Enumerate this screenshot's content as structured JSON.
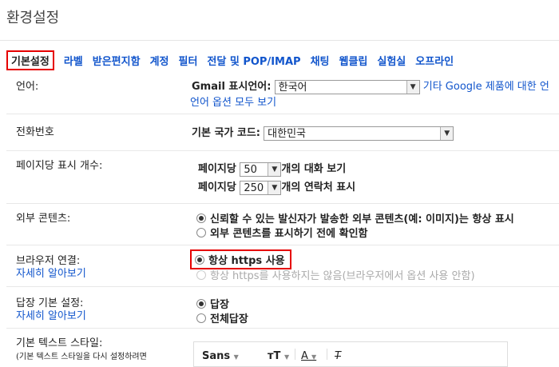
{
  "page": {
    "title": "환경설정"
  },
  "tabs": [
    {
      "label": "기본설정"
    },
    {
      "label": "라벨"
    },
    {
      "label": "받은편지함"
    },
    {
      "label": "계정"
    },
    {
      "label": "필터"
    },
    {
      "label": "전달 및 POP/IMAP"
    },
    {
      "label": "채팅"
    },
    {
      "label": "웹클립"
    },
    {
      "label": "실험실"
    },
    {
      "label": "오프라인"
    }
  ],
  "language": {
    "label": "언어:",
    "display_label": "Gmail 표시언어:",
    "selected": "한국어",
    "other_link": "기타 Google 제품에 대한 언",
    "more_link": "언어 옵션 모두 보기"
  },
  "phone": {
    "label": "전화번호",
    "country_label": "기본 국가 코드:",
    "selected": "대한민국"
  },
  "page_size": {
    "label": "페이지당 표시 개수:",
    "row1_prefix": "페이지당",
    "row1_value": "50",
    "row1_suffix": "개의 대화 보기",
    "row2_prefix": "페이지당",
    "row2_value": "250",
    "row2_suffix": "개의 연락처 표시"
  },
  "external": {
    "label": "외부 콘텐츠:",
    "opt1": "신뢰할 수 있는 발신자가 발송한 외부 콘텐츠(예: 이미지)는 항상 표시",
    "opt2": "외부 콘텐츠를 표시하기 전에 확인함"
  },
  "browser": {
    "label": "브라우저 연결:",
    "more_link": "자세히 알아보기",
    "opt1": "항상 https 사용",
    "opt2": "항상 https를 사용하지는 않음(브라우저에서 옵션 사용 안함)"
  },
  "reply": {
    "label": "답장 기본 설정:",
    "more_link": "자세히 알아보기",
    "opt1": "답장",
    "opt2": "전체답장"
  },
  "text_style": {
    "label": "기본 텍스트 스타일:",
    "sublabel": "(기본 텍스트 스타일을 다시 설정하려면",
    "font": "Sans"
  },
  "colors": {
    "link": "#1155cc",
    "highlight": "#e60000"
  }
}
